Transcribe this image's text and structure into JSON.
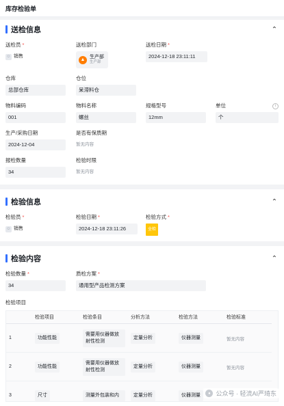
{
  "page": {
    "title": "库存检验单"
  },
  "sections": {
    "delivery": {
      "title": "送检信息",
      "sender_label": "送检员",
      "sender_value": "销售",
      "dept_label": "送检部门",
      "dept_name": "生产部",
      "dept_sub": "生产部",
      "date_label": "送检日期",
      "date_value": "2024-12-18 23:11:11",
      "warehouse_label": "仓库",
      "warehouse_value": "总部仓库",
      "location_label": "仓位",
      "location_value": "呆滞料仓",
      "code_label": "物料编码",
      "code_value": "001",
      "name_label": "物料名称",
      "name_value": "螺丝",
      "spec_label": "规格型号",
      "spec_value": "12mm",
      "unit_label": "单位",
      "unit_value": "个",
      "mfg_label": "生产/采购日期",
      "mfg_value": "2024-12-04",
      "shelf_label": "是否有保质期",
      "shelf_value": "暂无内容",
      "qty_label": "报检数量",
      "qty_value": "34",
      "limit_label": "检验时限",
      "limit_value": "暂无内容"
    },
    "inspect": {
      "title": "检验信息",
      "inspector_label": "检验员",
      "inspector_value": "销售",
      "date_label": "检验日期",
      "date_value": "2024-12-18 23:11:26",
      "method_label": "检验方式",
      "method_value": "全检"
    },
    "content": {
      "title": "检验内容",
      "qty_label": "检验数量",
      "qty_value": "34",
      "plan_label": "质检方案",
      "plan_value": "通用型产品检测方案",
      "items_label": "检验项目",
      "columns": [
        "检验项目",
        "检验条目",
        "分析方法",
        "检验方法",
        "检验标准"
      ],
      "rows": [
        {
          "no": "1",
          "item": "功能性能",
          "entry": "需要用仪器做放射性检测",
          "analysis": "定量分析",
          "method": "仪器测量",
          "standard": "暂无内容"
        },
        {
          "no": "2",
          "item": "功能性能",
          "entry": "需要用仪器做放射性检测",
          "analysis": "定量分析",
          "method": "仪器测量",
          "standard": "暂无内容"
        },
        {
          "no": "3",
          "item": "尺寸",
          "entry": "测量外包装和内",
          "analysis": "定量分析",
          "method": "仪器测量",
          "standard": ""
        }
      ]
    }
  },
  "watermark": "公众号 · 轻流AI严琦东"
}
